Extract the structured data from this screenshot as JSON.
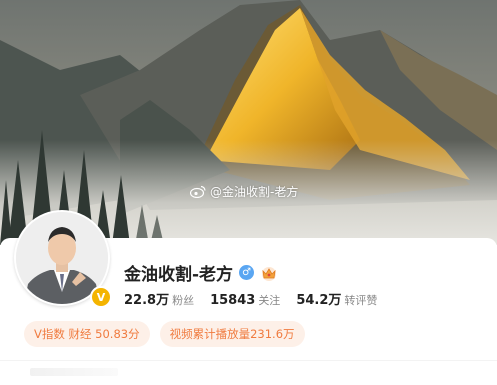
{
  "banner": {
    "watermark": "@金油收割-老方",
    "weibo_icon": "weibo-icon"
  },
  "profile": {
    "name": "金油收割-老方",
    "verified_badge": "V",
    "gender_icon": "male-icon",
    "gender_symbol": "♂",
    "level_icon": "crown-icon",
    "stats": [
      {
        "value": "22.8万",
        "label": "粉丝"
      },
      {
        "value": "15843",
        "label": "关注"
      },
      {
        "value": "54.2万",
        "label": "转评赞"
      }
    ],
    "tags": [
      "V指数 财经 50.83分",
      "视频累计播放量231.6万"
    ]
  },
  "colors": {
    "accent": "#f07b3f",
    "tag_bg": "#fdf0e8",
    "badge": "#f4b400",
    "gender": "#5aa6f2"
  }
}
